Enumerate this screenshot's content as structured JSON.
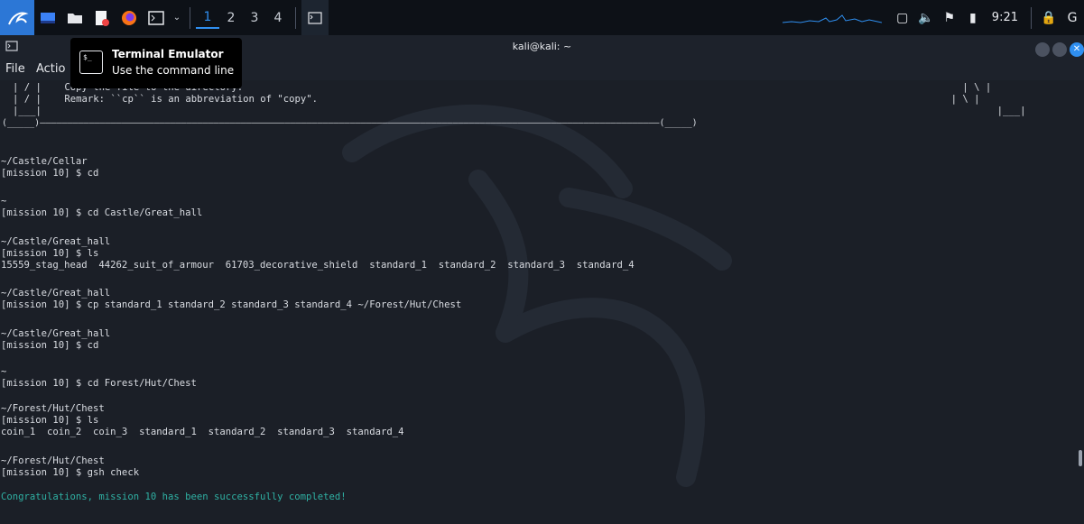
{
  "panel": {
    "workspaces": [
      "1",
      "2",
      "3",
      "4"
    ],
    "clock": "9:21"
  },
  "window": {
    "title": "kali@kali: ~",
    "menu": [
      "File",
      "Actio"
    ]
  },
  "tooltip": {
    "title": "Terminal Emulator",
    "subtitle": "Use the command line"
  },
  "terminal": {
    "lines": [
      "| / |    Copy the file to the directory.                                                                                                                             | \\ |",
      "| / |    Remark: ``cp`` is an abbreviation of \"copy\".                                                                                                              | \\ |",
      "|___|                                                                                                                                                                      |___|",
      "(_____)——————————————————————————————————————————————————————————————————————————————————————————————————————————————————(_____)",
      "~/Castle/Cellar",
      "[mission 10] $ cd",
      "~",
      "[mission 10] $ cd Castle/Great_hall",
      "~/Castle/Great_hall",
      "[mission 10] $ ls",
      "15559_stag_head  44262_suit_of_armour  61703_decorative_shield  standard_1  standard_2  standard_3  standard_4",
      "~/Castle/Great_hall",
      "[mission 10] $ cp standard_1 standard_2 standard_3 standard_4 ~/Forest/Hut/Chest",
      "~/Castle/Great_hall",
      "[mission 10] $ cd",
      "~",
      "[mission 10] $ cd Forest/Hut/Chest",
      "~/Forest/Hut/Chest",
      "[mission 10] $ ls",
      "coin_1  coin_2  coin_3  standard_1  standard_2  standard_3  standard_4",
      "~/Forest/Hut/Chest",
      "[mission 10] $ gsh check",
      "Congratulations, mission 10 has been successfully completed!"
    ]
  },
  "colors": {
    "panel_bg": "#0d1117",
    "terminal_bg": "#1b1f27",
    "success_text": "#2fb0a3",
    "accent": "#2f8ff0"
  }
}
